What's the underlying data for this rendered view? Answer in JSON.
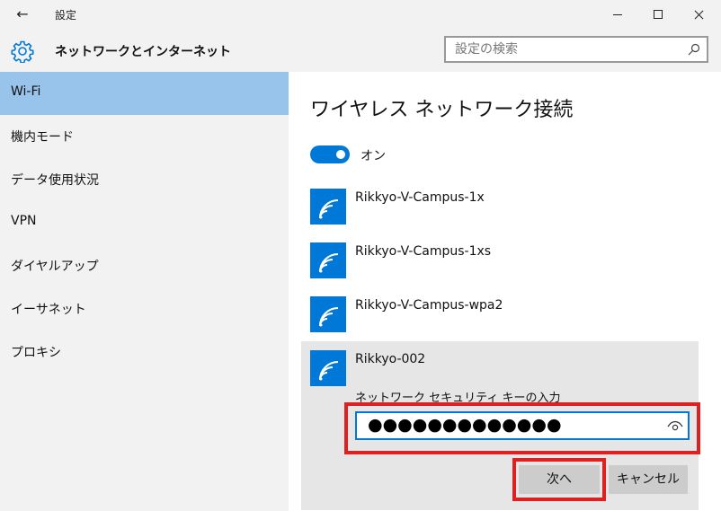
{
  "window": {
    "title": "設定",
    "back_symbol": "←"
  },
  "header": {
    "title": "ネットワークとインターネット",
    "search_placeholder": "設定の検索"
  },
  "sidebar": {
    "items": [
      {
        "label": "Wi-Fi",
        "active": true
      },
      {
        "label": "機内モード"
      },
      {
        "label": "データ使用状況"
      },
      {
        "label": "VPN"
      },
      {
        "label": "ダイヤルアップ"
      },
      {
        "label": "イーサネット"
      },
      {
        "label": "プロキシ"
      }
    ]
  },
  "main": {
    "title": "ワイヤレス ネットワーク接続",
    "toggle_label": "オン",
    "networks": [
      {
        "name": "Rikkyo-V-Campus-1x"
      },
      {
        "name": "Rikkyo-V-Campus-1xs"
      },
      {
        "name": "Rikkyo-V-Campus-wpa2"
      },
      {
        "name": "Rikkyo-002"
      }
    ],
    "key_label": "ネットワーク セキュリティ キーの入力",
    "password_mask": "●●●●●●●●●●●●●",
    "next_button": "次へ",
    "cancel_button": "キャンセル"
  },
  "colors": {
    "accent": "#0078d7",
    "active_nav": "#98c3ea",
    "highlight": "#e02020"
  },
  "icons": [
    "back-arrow-icon",
    "gear-icon",
    "search-icon",
    "wifi-icon",
    "reveal-password-eye-icon"
  ]
}
